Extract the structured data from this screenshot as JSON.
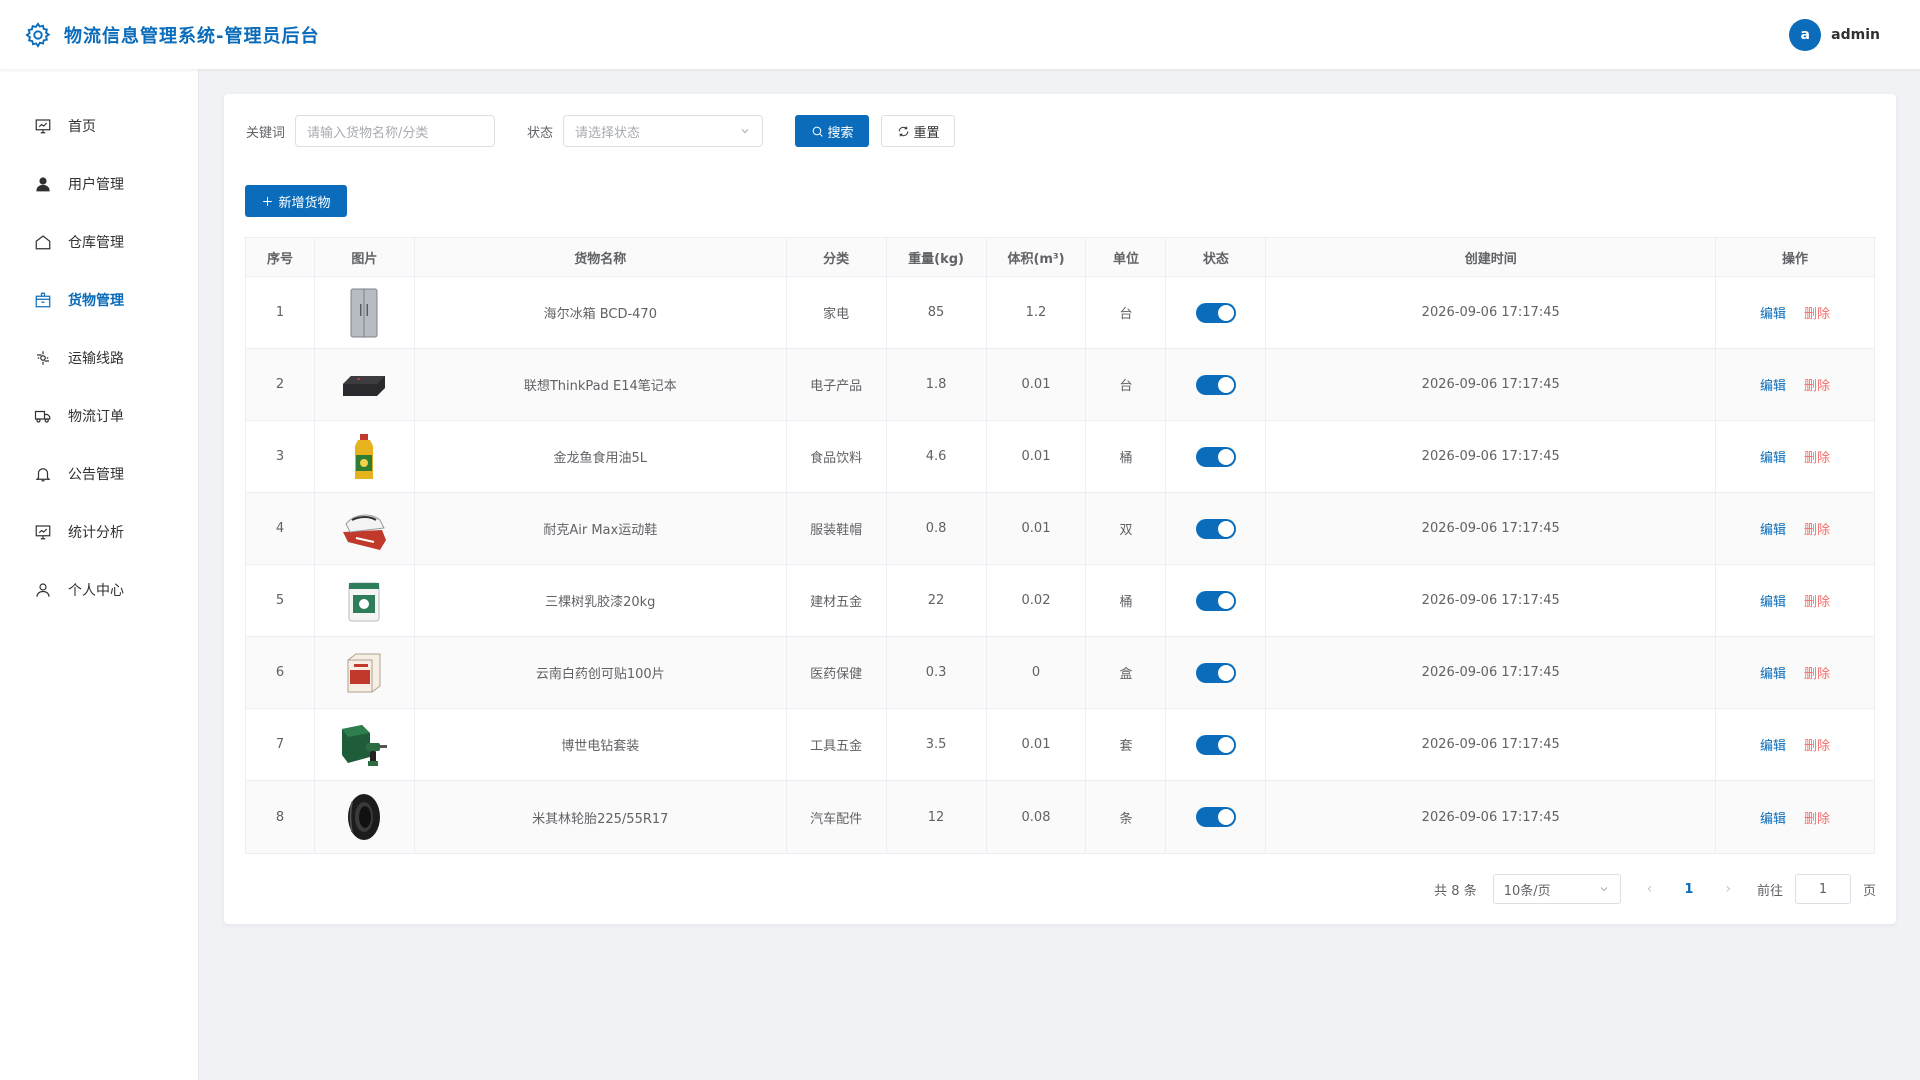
{
  "app": {
    "title": "物流信息管理系统-管理员后台"
  },
  "user": {
    "avatar_letter": "a",
    "name": "admin"
  },
  "sidebar": {
    "items": [
      {
        "label": "首页",
        "icon": "dashboard-icon",
        "active": false
      },
      {
        "label": "用户管理",
        "icon": "user-icon",
        "active": false
      },
      {
        "label": "仓库管理",
        "icon": "house-icon",
        "active": false
      },
      {
        "label": "货物管理",
        "icon": "box-icon",
        "active": true
      },
      {
        "label": "运输线路",
        "icon": "route-icon",
        "active": false
      },
      {
        "label": "物流订单",
        "icon": "truck-icon",
        "active": false
      },
      {
        "label": "公告管理",
        "icon": "bell-icon",
        "active": false
      },
      {
        "label": "统计分析",
        "icon": "chart-icon",
        "active": false
      },
      {
        "label": "个人中心",
        "icon": "person-icon",
        "active": false
      }
    ]
  },
  "filters": {
    "keyword_label": "关键词",
    "keyword_placeholder": "请输入货物名称/分类",
    "status_label": "状态",
    "status_placeholder": "请选择状态",
    "search_label": "搜索",
    "reset_label": "重置"
  },
  "toolbar": {
    "add_label": "新增货物"
  },
  "table": {
    "headers": [
      "序号",
      "图片",
      "货物名称",
      "分类",
      "重量(kg)",
      "体积(m³)",
      "单位",
      "状态",
      "创建时间",
      "操作"
    ],
    "edit_label": "编辑",
    "delete_label": "删除",
    "rows": [
      {
        "no": "1",
        "name": "海尔冰箱 BCD-470",
        "category": "家电",
        "weight": "85",
        "volume": "1.2",
        "unit": "台",
        "enabled": true,
        "created": "2026-09-06 17:17:45",
        "image": "fridge-image"
      },
      {
        "no": "2",
        "name": "联想ThinkPad E14笔记本",
        "category": "电子产品",
        "weight": "1.8",
        "volume": "0.01",
        "unit": "台",
        "enabled": true,
        "created": "2026-09-06 17:17:45",
        "image": "laptop-image"
      },
      {
        "no": "3",
        "name": "金龙鱼食用油5L",
        "category": "食品饮料",
        "weight": "4.6",
        "volume": "0.01",
        "unit": "桶",
        "enabled": true,
        "created": "2026-09-06 17:17:45",
        "image": "oil-bottle-image"
      },
      {
        "no": "4",
        "name": "耐克Air Max运动鞋",
        "category": "服装鞋帽",
        "weight": "0.8",
        "volume": "0.01",
        "unit": "双",
        "enabled": true,
        "created": "2026-09-06 17:17:45",
        "image": "sneaker-image"
      },
      {
        "no": "5",
        "name": "三棵树乳胶漆20kg",
        "category": "建材五金",
        "weight": "22",
        "volume": "0.02",
        "unit": "桶",
        "enabled": true,
        "created": "2026-09-06 17:17:45",
        "image": "paint-bucket-image"
      },
      {
        "no": "6",
        "name": "云南白药创可贴100片",
        "category": "医药保健",
        "weight": "0.3",
        "volume": "0",
        "unit": "盒",
        "enabled": true,
        "created": "2026-09-06 17:17:45",
        "image": "medicine-box-image"
      },
      {
        "no": "7",
        "name": "博世电钻套装",
        "category": "工具五金",
        "weight": "3.5",
        "volume": "0.01",
        "unit": "套",
        "enabled": true,
        "created": "2026-09-06 17:17:45",
        "image": "drill-kit-image"
      },
      {
        "no": "8",
        "name": "米其林轮胎225/55R17",
        "category": "汽车配件",
        "weight": "12",
        "volume": "0.08",
        "unit": "条",
        "enabled": true,
        "created": "2026-09-06 17:17:45",
        "image": "tire-image"
      }
    ]
  },
  "pagination": {
    "total_text": "共 8 条",
    "page_size": "10条/页",
    "current_page": "1",
    "goto_label": "前往",
    "goto_value": "1",
    "page_suffix": "页"
  },
  "colors": {
    "primary": "#0a6cba",
    "danger": "#f56c6c"
  }
}
